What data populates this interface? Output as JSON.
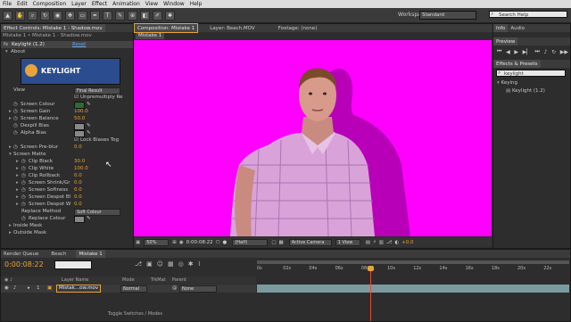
{
  "menu": [
    "File",
    "Edit",
    "Composition",
    "Layer",
    "Effect",
    "Animation",
    "View",
    "Window",
    "Help"
  ],
  "toolbar": {
    "workspace_label": "Workspace:",
    "workspace_value": "Standard",
    "search_placeholder": "Search Help"
  },
  "effect_controls": {
    "tab_label": "Effect Controls: Mistake 1 - Shadow.mov",
    "layer_path": "Mistake 1 • Mistake 1 - Shadow.mov",
    "effect_name": "Keylight (1.2)",
    "reset_label": "Reset",
    "about_label": "About",
    "logo_text": "KEYLIGHT",
    "view_label": "View",
    "view_value": "Final Result",
    "unpremultiply_label": "Unpremultiply Re",
    "screen_colour_label": "Screen Colour",
    "screen_gain_label": "Screen Gain",
    "screen_gain_value": "100.0",
    "screen_balance_label": "Screen Balance",
    "screen_balance_value": "50.0",
    "despill_bias_label": "Despill Bias",
    "alpha_bias_label": "Alpha Bias",
    "lock_biases_label": "Lock Biases Tog",
    "screen_preblur_label": "Screen Pre-blur",
    "screen_preblur_value": "0.0",
    "screen_matte_label": "Screen Matte",
    "clip_black_label": "Clip Black",
    "clip_black_value": "30.0",
    "clip_white_label": "Clip White",
    "clip_white_value": "100.0",
    "clip_rollback_label": "Clip Rollback",
    "clip_rollback_value": "0.0",
    "shrink_label": "Screen Shrink/Gr",
    "shrink_value": "0.0",
    "softness_label": "Screen Softness",
    "softness_value": "0.0",
    "despot_black_label": "Screen Despot Bl",
    "despot_black_value": "0.0",
    "despot_white_label": "Screen Despot W",
    "despot_white_value": "0.0",
    "replace_method_label": "Replace Method",
    "replace_method_value": "Soft Colour",
    "replace_colour_label": "Replace Colour",
    "inside_mask_label": "Inside Mask",
    "outside_mask_label": "Outside Mask",
    "screen_colour_hex": "#2f6b2f"
  },
  "composition": {
    "tab_label": "Composition: Mistake 1",
    "layer_tab_label": "Layer: Beach.MOV",
    "footage_tab_label": "Footage: (none)",
    "sub_tab_label": "Mistake 1",
    "background_hex": "#ff00ff",
    "zoom": "50%",
    "timecode": "0:00:08:22",
    "resolution": "(Half)",
    "camera": "Active Camera",
    "views": "1 View",
    "exposure": "+0.0"
  },
  "right_panels": {
    "info_tab": "Info",
    "audio_tab": "Audio",
    "preview_tab": "Preview",
    "effects_tab": "Effects & Presets",
    "search_value": "keylight",
    "category": "Keying",
    "effect_item": "Keylight (1.2)"
  },
  "timeline": {
    "render_queue_tab": "Render Queue",
    "beach_tab": "Beach",
    "mistake_tab": "Mistake 1",
    "timecode": "0:00:08:22",
    "col_layer_name": "Layer Name",
    "col_mode": "Mode",
    "col_trkmat": "TrkMat",
    "col_parent": "Parent",
    "layer_index": "1",
    "layer_name": "Mistak...ow.mov",
    "layer_mode": "Normal",
    "layer_parent": "None",
    "ruler": [
      "0s",
      "02s",
      "04s",
      "06s",
      "08s",
      "10s",
      "12s",
      "14s",
      "16s",
      "18s",
      "20s",
      "22s"
    ],
    "toggle_label": "Toggle Switches / Modes",
    "playhead_seconds": 8.73
  }
}
